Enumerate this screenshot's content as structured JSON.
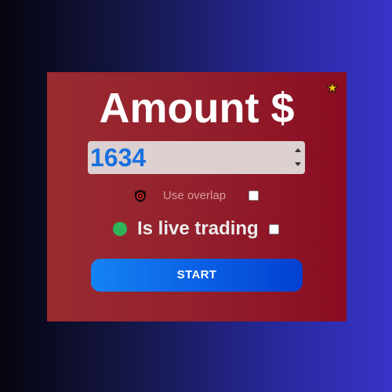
{
  "panel": {
    "title": "Amount $",
    "favorite_icon": "star-icon",
    "amount": {
      "value": "1634"
    },
    "overlap": {
      "icon": "shield-icon",
      "label": "Use overlap",
      "checked": false
    },
    "live": {
      "status_color": "#2fb457",
      "label": "Is live trading",
      "checked": false
    },
    "start_button": {
      "label": "START"
    }
  },
  "colors": {
    "panel_bg": "#93202c",
    "button_blue": "#0a5ee3",
    "amount_text": "#1a6fe0"
  }
}
